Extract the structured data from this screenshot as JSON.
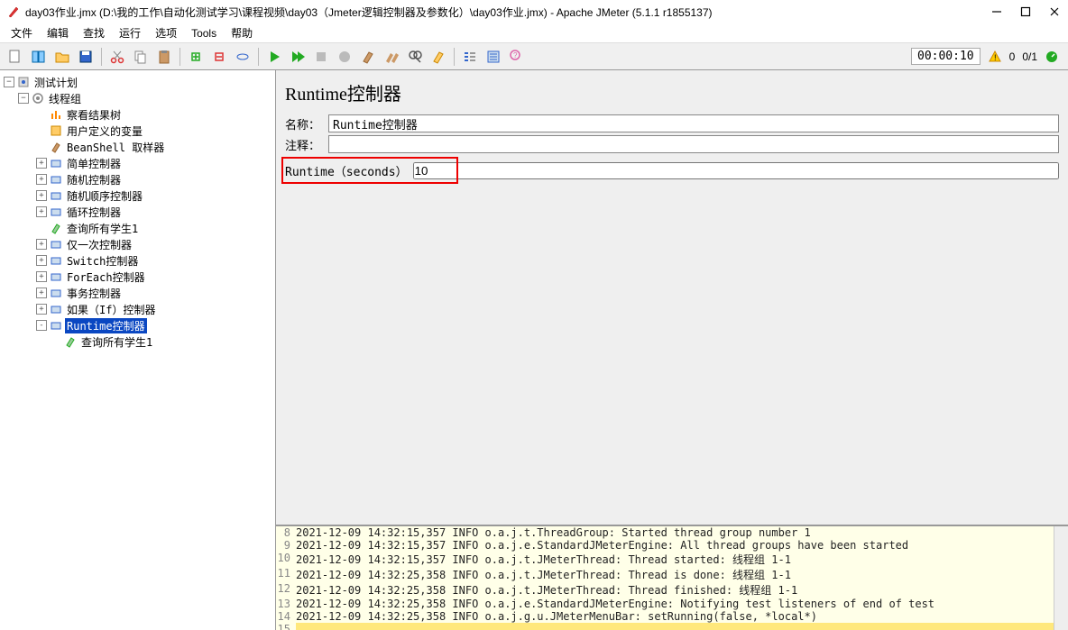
{
  "window": {
    "title": "day03作业.jmx (D:\\我的工作\\自动化测试学习\\课程视频\\day03（Jmeter逻辑控制器及参数化）\\day03作业.jmx) - Apache JMeter (5.1.1 r1855137)"
  },
  "menu": {
    "file": "文件",
    "edit": "编辑",
    "search": "查找",
    "run": "运行",
    "options": "选项",
    "tools": "Tools",
    "help": "帮助"
  },
  "status": {
    "timer": "00:00:10",
    "warn_count": "0",
    "thread_count": "0/1"
  },
  "tree": {
    "root": "测试计划",
    "thread_group": "线程组",
    "children": [
      "察看结果树",
      "用户定义的变量",
      "BeanShell 取样器",
      "简单控制器",
      "随机控制器",
      "随机顺序控制器",
      "循环控制器",
      "查询所有学生1",
      "仅一次控制器",
      "Switch控制器",
      "ForEach控制器",
      "事务控制器",
      "如果（If）控制器",
      "Runtime控制器",
      "查询所有学生1"
    ],
    "selected_index": 13
  },
  "editor": {
    "heading": "Runtime控制器",
    "name_label": "名称：",
    "name_value": "Runtime控制器",
    "comment_label": "注释：",
    "comment_value": "",
    "runtime_label": "Runtime（seconds）",
    "runtime_value": "10"
  },
  "log": {
    "lines": [
      {
        "n": 8,
        "t": "2021-12-09 14:32:15,357 INFO o.a.j.t.ThreadGroup: Started thread group number 1"
      },
      {
        "n": 9,
        "t": "2021-12-09 14:32:15,357 INFO o.a.j.e.StandardJMeterEngine: All thread groups have been started"
      },
      {
        "n": 10,
        "t": "2021-12-09 14:32:15,357 INFO o.a.j.t.JMeterThread: Thread started: 线程组 1-1"
      },
      {
        "n": 11,
        "t": "2021-12-09 14:32:25,358 INFO o.a.j.t.JMeterThread: Thread is done: 线程组 1-1"
      },
      {
        "n": 12,
        "t": "2021-12-09 14:32:25,358 INFO o.a.j.t.JMeterThread: Thread finished: 线程组 1-1"
      },
      {
        "n": 13,
        "t": "2021-12-09 14:32:25,358 INFO o.a.j.e.StandardJMeterEngine: Notifying test listeners of end of test"
      },
      {
        "n": 14,
        "t": "2021-12-09 14:32:25,358 INFO o.a.j.g.u.JMeterMenuBar: setRunning(false, *local*)"
      },
      {
        "n": 15,
        "t": ""
      }
    ],
    "highlight_n": 15
  },
  "icons": {
    "colors": {
      "green": "#2a2",
      "red": "#d33",
      "blue": "#39f",
      "orange": "#f80",
      "purple": "#96c",
      "gray": "#888"
    }
  },
  "tree_meta": [
    {
      "toggle": "",
      "icon": "result"
    },
    {
      "toggle": "",
      "icon": "vars"
    },
    {
      "toggle": "",
      "icon": "beanshell"
    },
    {
      "toggle": "+",
      "icon": "ctrl"
    },
    {
      "toggle": "+",
      "icon": "ctrl"
    },
    {
      "toggle": "+",
      "icon": "ctrl"
    },
    {
      "toggle": "+",
      "icon": "ctrl"
    },
    {
      "toggle": "",
      "icon": "sampler"
    },
    {
      "toggle": "+",
      "icon": "ctrl"
    },
    {
      "toggle": "+",
      "icon": "ctrl"
    },
    {
      "toggle": "+",
      "icon": "ctrl"
    },
    {
      "toggle": "+",
      "icon": "ctrl"
    },
    {
      "toggle": "+",
      "icon": "ctrl"
    },
    {
      "toggle": "-",
      "icon": "ctrl"
    },
    {
      "toggle": "",
      "icon": "sampler"
    }
  ]
}
